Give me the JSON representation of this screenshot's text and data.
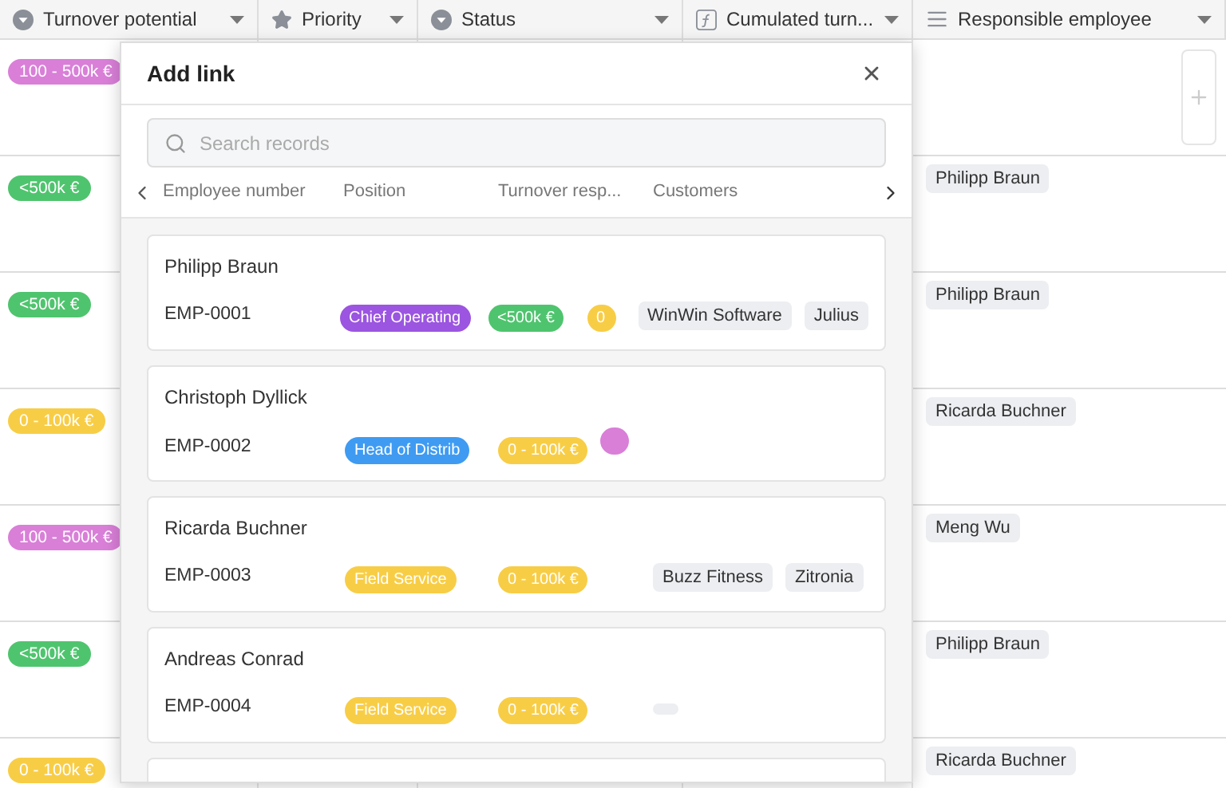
{
  "table": {
    "columns": [
      {
        "label": "Turnover potential",
        "kind": "select"
      },
      {
        "label": "Priority",
        "kind": "rating"
      },
      {
        "label": "Status",
        "kind": "select"
      },
      {
        "label": "Cumulated turn...",
        "kind": "formula"
      },
      {
        "label": "Responsible employee",
        "kind": "link"
      }
    ],
    "rows": [
      {
        "turnover": {
          "label": "100 - 500k €",
          "color": "#d97fd8"
        },
        "employees": [],
        "add_button": true
      },
      {
        "turnover": {
          "label": "<500k €",
          "color": "#4fc46e"
        },
        "employees": [
          "Philipp Braun"
        ],
        "add_button": false
      },
      {
        "turnover": {
          "label": "<500k €",
          "color": "#4fc46e"
        },
        "employees": [
          "Philipp Braun"
        ],
        "add_button": false
      },
      {
        "turnover": {
          "label": "0 - 100k €",
          "color": "#f8cd46"
        },
        "employees": [
          "Ricarda Buchner"
        ],
        "add_button": false
      },
      {
        "turnover": {
          "label": "100 - 500k €",
          "color": "#d97fd8"
        },
        "employees": [
          "Meng Wu"
        ],
        "add_button": false
      },
      {
        "turnover": {
          "label": "<500k €",
          "color": "#4fc46e"
        },
        "employees": [
          "Philipp Braun"
        ],
        "add_button": false
      },
      {
        "turnover": {
          "label": "0 - 100k €",
          "color": "#f8cd46"
        },
        "employees": [
          "Ricarda Buchner"
        ],
        "add_button": false
      }
    ]
  },
  "modal": {
    "title": "Add link",
    "search": {
      "placeholder": "Search records"
    },
    "columns": [
      "Employee number",
      "Position",
      "Turnover resp...",
      "Customers"
    ],
    "records": [
      {
        "name": "Philipp Braun",
        "number": "EMP-0001",
        "position": {
          "label": "Chief Operating",
          "color": "#9b55e0"
        },
        "turnover": {
          "label": "<500k €",
          "color": "#4fc46e"
        },
        "extra": {
          "label": "0",
          "color": "#f8cd46"
        },
        "customers": [
          "WinWin Software",
          "Julius"
        ],
        "blank_chip": false
      },
      {
        "name": "Christoph Dyllick",
        "number": "EMP-0002",
        "position": {
          "label": "Head of Distrib",
          "color": "#3f9bf2"
        },
        "turnover": {
          "label": "0 - 100k €",
          "color": "#f8cd46"
        },
        "extra": {
          "color": "#d97fd8"
        },
        "blank_chip": false
      },
      {
        "name": "Ricarda Buchner",
        "number": "EMP-0003",
        "position": {
          "label": "Field Service",
          "color": "#f8cd46"
        },
        "turnover": {
          "label": "0 - 100k €",
          "color": "#f8cd46"
        },
        "customers": [
          "Buzz Fitness",
          "Zitronia"
        ],
        "blank_chip": false
      },
      {
        "name": "Andreas Conrad",
        "number": "EMP-0004",
        "position": {
          "label": "Field Service",
          "color": "#f8cd46"
        },
        "turnover": {
          "label": "0 - 100k €",
          "color": "#f8cd46"
        },
        "blank_chip": true
      }
    ],
    "more_records": true
  }
}
